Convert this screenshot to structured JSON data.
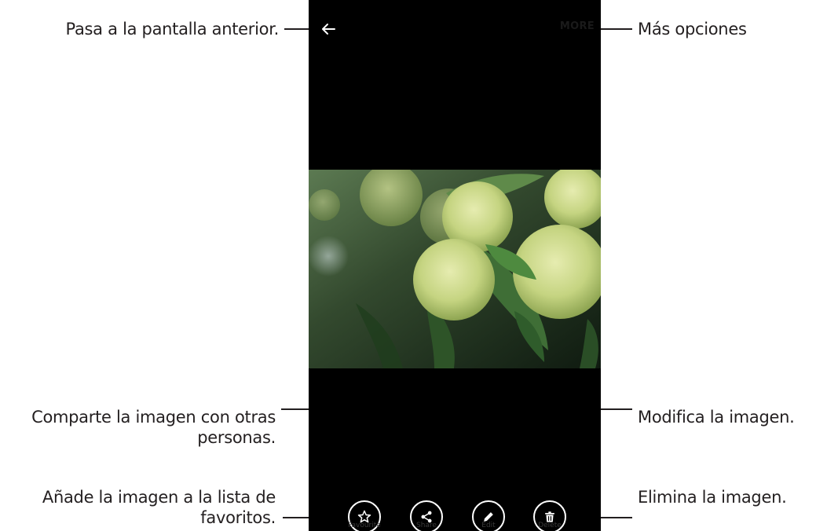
{
  "screen": {
    "more_label": "MORE",
    "actions": [
      {
        "label": "Favourite",
        "icon": "star-icon"
      },
      {
        "label": "Share",
        "icon": "share-icon"
      },
      {
        "label": "Edit",
        "icon": "pencil-icon"
      },
      {
        "label": "Delete",
        "icon": "trash-icon"
      }
    ]
  },
  "callouts": {
    "back": "Pasa a la pantalla anterior.",
    "more": "Más opciones",
    "share_line1": "Comparte la imagen con otras",
    "share_line2": "personas.",
    "edit": "Modifica la imagen.",
    "favourite_line1": "Añade la imagen a la lista de",
    "favourite_line2": "favoritos.",
    "delete": "Elimina la imagen."
  },
  "colors": {
    "screen_background": "#000000",
    "text": "#231f20",
    "icon": "#ffffff"
  }
}
